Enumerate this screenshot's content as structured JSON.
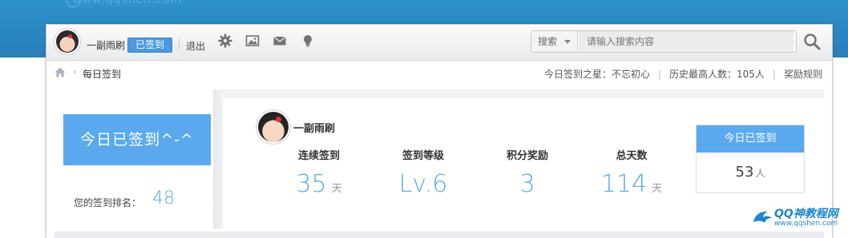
{
  "site": {
    "url_text": "www.qqshen.com"
  },
  "topbar": {
    "username": "一副雨刷",
    "signed_badge": "已签到",
    "logout": "退出",
    "icons": [
      "gear-icon",
      "image-icon",
      "mail-icon",
      "lightbulb-icon"
    ],
    "search": {
      "type_label": "搜索",
      "placeholder": "请输入搜索内容"
    }
  },
  "breadcrumb": {
    "current": "每日签到",
    "star_label": "今日签到之星：",
    "star_name": "不忘初心",
    "record_label": "历史最高人数：",
    "record_value": "105人",
    "rules_link": "奖励规则"
  },
  "left": {
    "sign_button": "今日已签到^-^",
    "rank_label": "您的签到排名：",
    "rank_value": "48"
  },
  "main": {
    "name": "一副雨刷",
    "stats": [
      {
        "label": "连续签到",
        "value": "35",
        "unit": "天"
      },
      {
        "label": "签到等级",
        "value": "Lv.6",
        "unit": ""
      },
      {
        "label": "积分奖励",
        "value": "3",
        "unit": ""
      },
      {
        "label": "总天数",
        "value": "114",
        "unit": "天"
      }
    ],
    "today": {
      "title": "今日已签到",
      "count": "53",
      "unit": "人"
    }
  },
  "watermark": {
    "title": "QQ神教程网",
    "url": "www.qqshen.com"
  },
  "colors": {
    "accent": "#5aa9ee",
    "header_blue": "#2a86c0",
    "watermark_blue": "#1f86d0"
  }
}
